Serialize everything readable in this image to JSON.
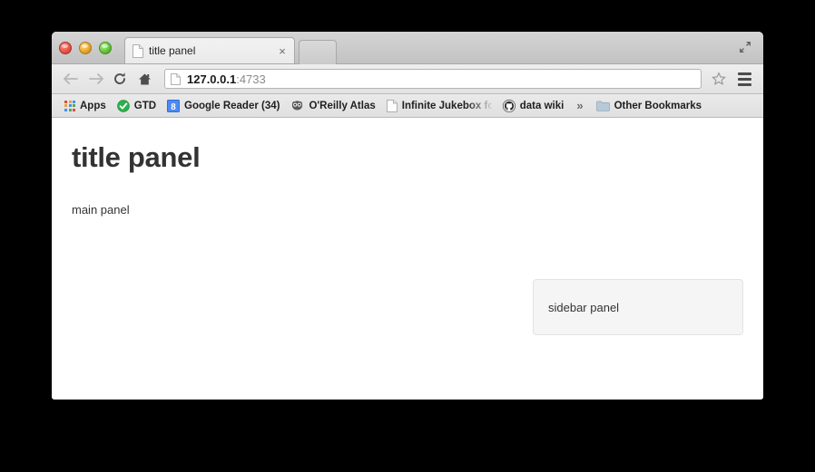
{
  "window": {
    "fullscreen_icon": "fullscreen-expand-icon",
    "traffic_lights": [
      "close-button",
      "minimize-button",
      "zoom-button"
    ]
  },
  "tabstrip": {
    "active_tab": {
      "title": "title panel",
      "favicon": "page-icon",
      "close_label": "×"
    },
    "new_tab_stub": "new-tab-stub"
  },
  "toolbar": {
    "back_icon": "back-arrow-icon",
    "forward_icon": "forward-arrow-icon",
    "reload_icon": "reload-icon",
    "home_icon": "home-icon",
    "omnibox": {
      "favicon": "page-icon",
      "url_host": "127.0.0.1",
      "url_rest": ":4733"
    },
    "star_icon": "bookmark-star-icon",
    "menu_icon": "chrome-menu-icon"
  },
  "bookmarks": {
    "items": [
      {
        "label": "Apps",
        "icon": "apps-grid-icon"
      },
      {
        "label": "GTD",
        "icon": "green-check-icon"
      },
      {
        "label": "Google Reader (34)",
        "icon": "google-favicon-icon"
      },
      {
        "label": "O'Reilly Atlas",
        "icon": "tarsier-icon"
      },
      {
        "label": "Infinite Jukebox for D",
        "icon": "page-icon"
      },
      {
        "label": "data wiki",
        "icon": "github-octocat-icon"
      }
    ],
    "overflow_label": "»",
    "other_bookmarks": {
      "label": "Other Bookmarks",
      "icon": "folder-icon"
    }
  },
  "page": {
    "title": "title panel",
    "main_panel": "main panel",
    "sidebar_panel": "sidebar panel"
  },
  "colors": {
    "page_background": "#ffffff",
    "desktop_background": "#000000",
    "well_background": "#f5f5f5",
    "well_border": "#e3e3e3",
    "text": "#333333"
  }
}
